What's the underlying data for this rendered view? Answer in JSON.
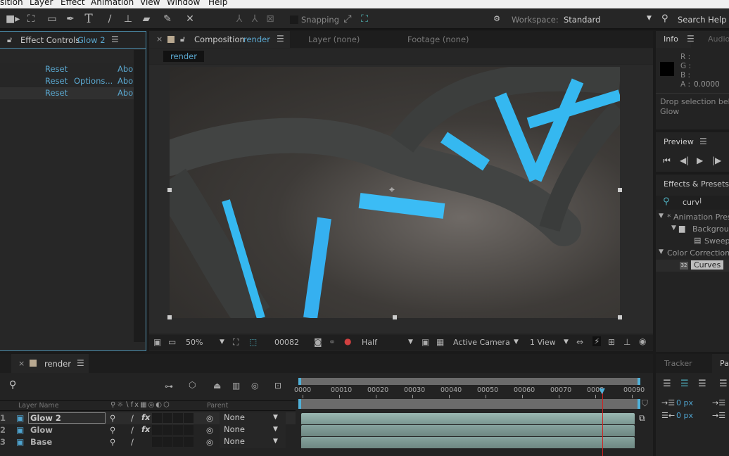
{
  "menubar": {
    "items": [
      "sition",
      "Layer",
      "Effect",
      "Animation",
      "View",
      "Window",
      "Help"
    ]
  },
  "toolbar": {
    "tools": [
      "camera-icon",
      "pan-behind-icon",
      "rectangle-icon",
      "pen-icon",
      "type-icon",
      "brush-icon",
      "clone-stamp-icon",
      "eraser-icon",
      "roto-brush-icon",
      "puppet-pin-icon"
    ],
    "axis_tools": [
      "local-axis-icon",
      "world-axis-icon",
      "view-axis-icon"
    ],
    "snapping_label": "Snapping",
    "workspace_label": "Workspace:",
    "workspace_value": "Standard",
    "search_help": "Search Help"
  },
  "effect_controls": {
    "tab_label": "Effect Controls",
    "tab_layer": "Glow 2",
    "rows": [
      {
        "reset": "Reset",
        "options": "",
        "about": "Abo"
      },
      {
        "reset": "Reset",
        "options": "Options...",
        "about": "Abo"
      },
      {
        "reset": "Reset",
        "options": "",
        "about": "Abo"
      }
    ]
  },
  "composition": {
    "tab_label": "Composition",
    "tab_comp": "render",
    "layer_tab": "Layer (none)",
    "footage_tab": "Footage (none)",
    "breadcrumb": "render",
    "footer": {
      "zoom": "50%",
      "timecode": "00082",
      "resolution": "Half",
      "camera": "Active Camera",
      "views": "1 View"
    }
  },
  "info": {
    "tab": "Info",
    "audio_tab": "Audio",
    "r": "R :",
    "g": "G :",
    "b": "B :",
    "a": "A :",
    "a_value": "0.0000",
    "message_line1": "Drop selection beh",
    "message_line2": "Glow",
    "swatch_color": "#000000"
  },
  "preview": {
    "title": "Preview"
  },
  "effects_presets": {
    "title": "Effects & Presets",
    "search_value": "curv",
    "tree": [
      {
        "label": "* Animation Prese",
        "level": 0,
        "type": "folder-open"
      },
      {
        "label": "Backgroun",
        "level": 1,
        "type": "folder"
      },
      {
        "label": "Sweepi",
        "level": 2,
        "type": "preset"
      },
      {
        "label": "Color Correction",
        "level": 0,
        "type": "category"
      },
      {
        "label": "Curves",
        "level": 1,
        "type": "effect",
        "selected": true
      }
    ]
  },
  "timeline": {
    "tab": "render",
    "columns": {
      "layer_name": "Layer Name",
      "parent": "Parent"
    },
    "ruler_labels": [
      "0000",
      "00010",
      "00020",
      "00030",
      "00040",
      "00050",
      "00060",
      "00070",
      "0008",
      "00090"
    ],
    "current_frame": 82,
    "total_frames": 90,
    "layers": [
      {
        "index": "1",
        "name": "Glow 2",
        "selected": true,
        "has_fx": true,
        "parent": "None"
      },
      {
        "index": "2",
        "name": "Glow",
        "selected": false,
        "has_fx": true,
        "parent": "None"
      },
      {
        "index": "3",
        "name": "Base",
        "selected": false,
        "has_fx": false,
        "parent": "None"
      }
    ]
  },
  "tracker": {
    "tab": "Tracker",
    "paragraph_tab": "Pa",
    "indent_left": "0 px",
    "indent_right": "0 px"
  },
  "colors": {
    "accent": "#5aa7cf",
    "playhead": "#d02020",
    "layer_bar": "#7e9a95"
  }
}
